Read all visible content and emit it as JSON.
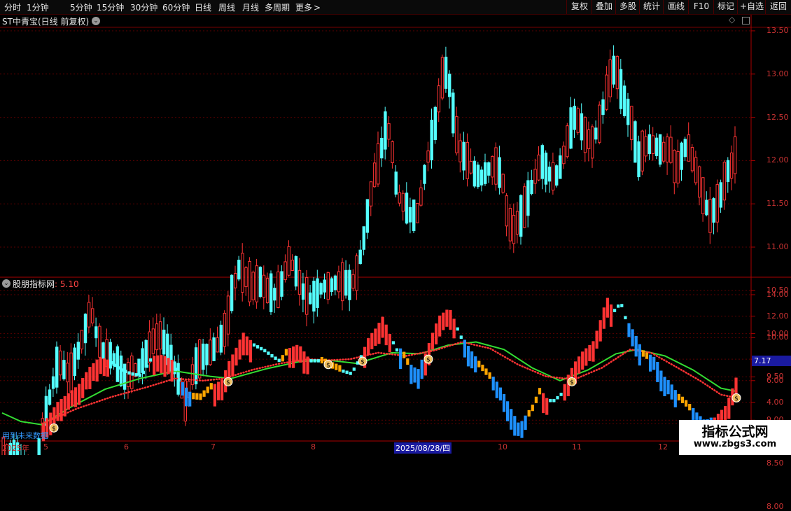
{
  "toolbar": {
    "periods": [
      "分时",
      "1分钟",
      "5分钟",
      "15分钟",
      "30分钟",
      "60分钟",
      "日线",
      "周线",
      "月线",
      "多周期",
      "更多"
    ],
    "more_arrow": ">",
    "active_period": "日线",
    "right_buttons": [
      "复权",
      "叠加",
      "多股",
      "统计",
      "画线",
      "F10",
      "标记",
      "+自选",
      "返回"
    ]
  },
  "main_chart": {
    "title": "ST中青宝(日线 前复权)",
    "y_ticks": [
      "13.50",
      "13.00",
      "12.50",
      "12.00",
      "11.50",
      "11.00",
      "10.50",
      "10.00",
      "9.50",
      "9.00",
      "8.50",
      "8.00"
    ],
    "y_values": [
      13.5,
      13.0,
      12.5,
      12.0,
      11.5,
      11.0,
      10.5,
      10.0,
      9.5,
      9.0,
      8.5,
      8.0
    ]
  },
  "indicator": {
    "name": "股朋指标网",
    "value_label": ": 5.10",
    "y_ticks": [
      "14.00",
      "12.00",
      "10.00",
      "8.00",
      "6.00",
      "4.00",
      "2.00"
    ],
    "y_values": [
      14,
      12,
      10,
      8,
      6,
      4,
      2
    ],
    "current_value": "7.17",
    "overlay_text": "用到未来数据"
  },
  "date_axis": {
    "labels": [
      "2025年",
      "5",
      "6",
      "7",
      "8",
      "2025/08/28/四",
      "10",
      "11",
      "12"
    ],
    "highlighted": "2025/08/28/四"
  },
  "watermark": {
    "line1": "指标公式网",
    "line2": "www.zbgs3.com"
  },
  "colors": {
    "up": "#ff3333",
    "down": "#54ffff",
    "background": "#000000",
    "grid": "#5a0000",
    "ma_line": "#33dd33",
    "dot_line": "#ff3333",
    "blue_bar": "#1e90ff",
    "orange_bar": "#ffa500"
  }
}
